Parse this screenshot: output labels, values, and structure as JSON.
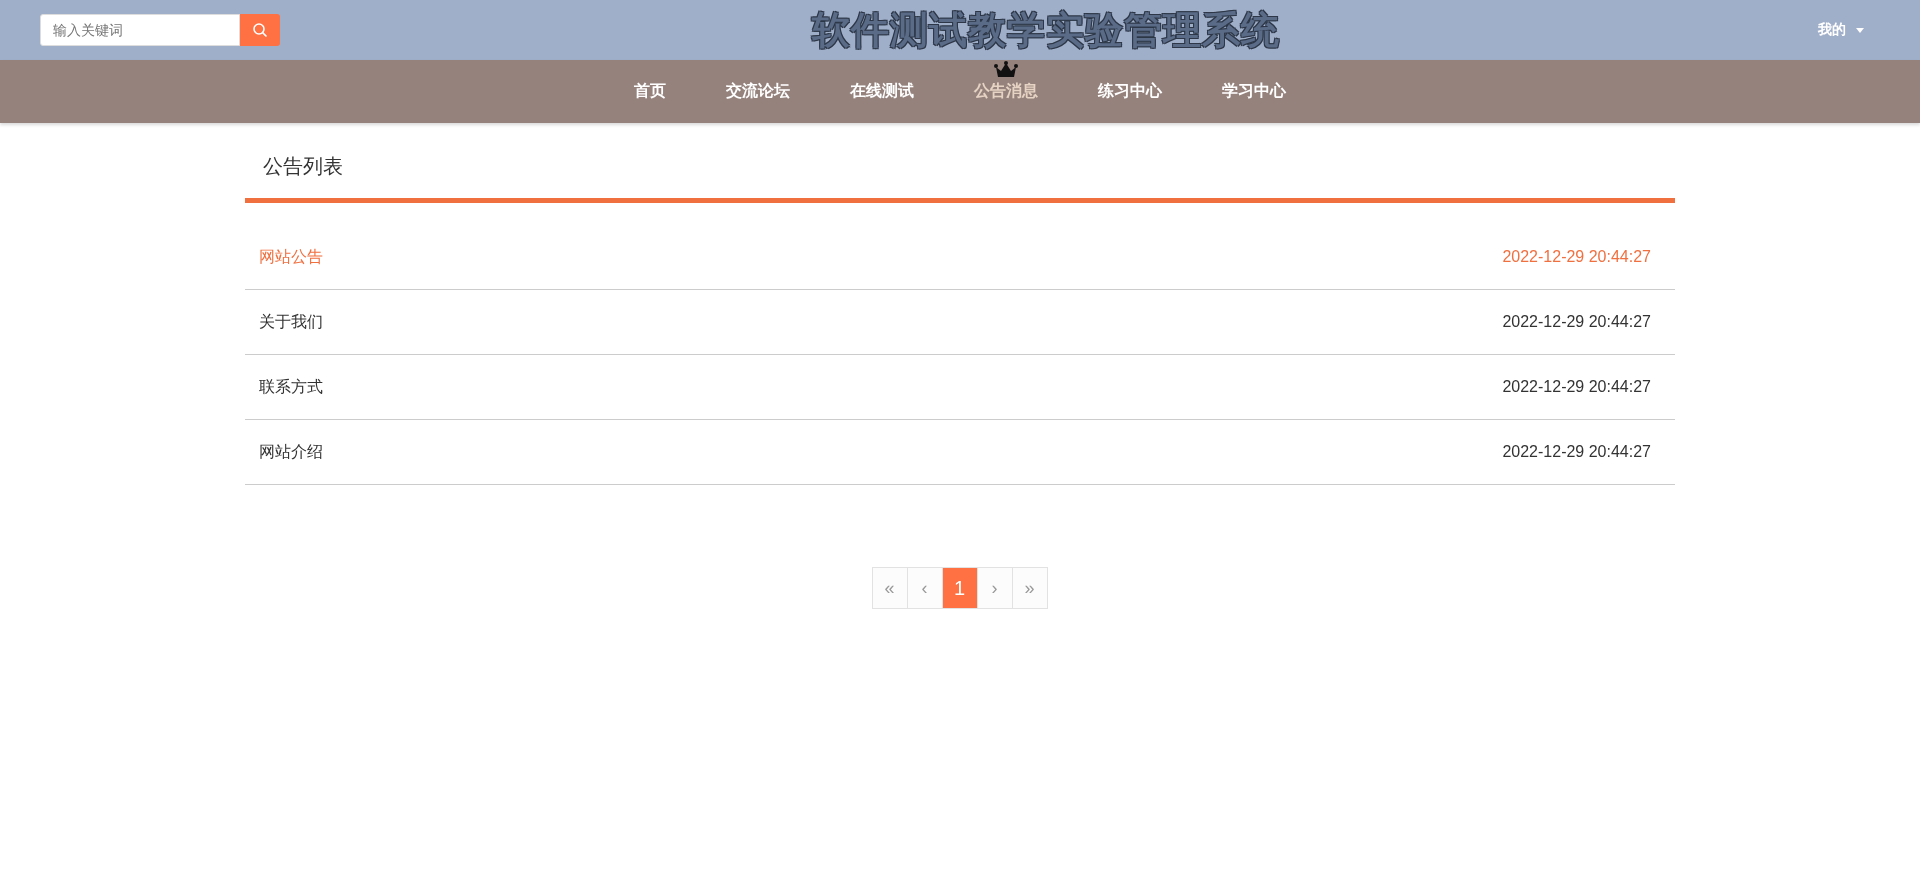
{
  "search": {
    "placeholder": "输入关键词"
  },
  "site_title": "软件测试教学实验管理系统",
  "user_menu": {
    "label": "我的"
  },
  "nav": [
    {
      "label": "首页",
      "selected": false
    },
    {
      "label": "交流论坛",
      "selected": false
    },
    {
      "label": "在线测试",
      "selected": false
    },
    {
      "label": "公告消息",
      "selected": true
    },
    {
      "label": "练习中心",
      "selected": false
    },
    {
      "label": "学习中心",
      "selected": false
    }
  ],
  "panel": {
    "title": "公告列表"
  },
  "notices": [
    {
      "title": "网站公告",
      "time": "2022-12-29 20:44:27",
      "selected": true
    },
    {
      "title": "关于我们",
      "time": "2022-12-29 20:44:27",
      "selected": false
    },
    {
      "title": "联系方式",
      "time": "2022-12-29 20:44:27",
      "selected": false
    },
    {
      "title": "网站介绍",
      "time": "2022-12-29 20:44:27",
      "selected": false
    }
  ],
  "pagination": [
    {
      "label": "«",
      "selected": false
    },
    {
      "label": "‹",
      "selected": false
    },
    {
      "label": "1",
      "selected": true
    },
    {
      "label": "›",
      "selected": false
    },
    {
      "label": "»",
      "selected": false
    }
  ]
}
